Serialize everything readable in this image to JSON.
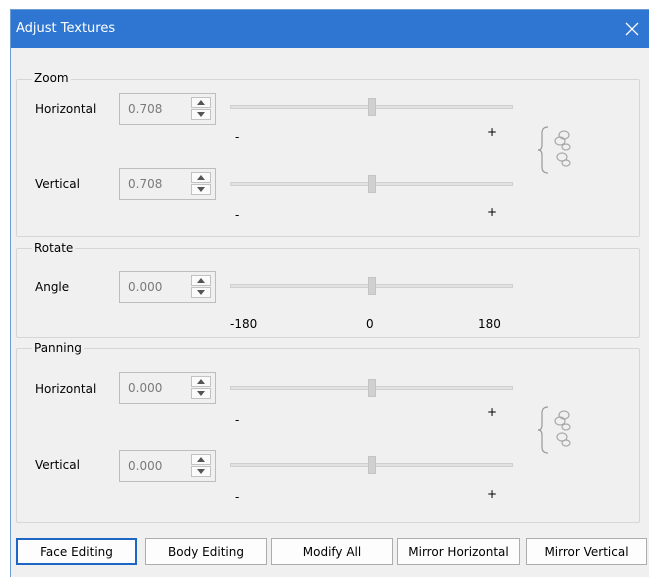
{
  "window": {
    "title": "Adjust Textures"
  },
  "icons": {
    "close": "close-icon",
    "link": "chain-link-icon",
    "up": "arrow-up-icon",
    "down": "arrow-down-icon"
  },
  "colors": {
    "titlebar": "#2e76d2",
    "accent": "#1e66c4"
  },
  "zoom": {
    "label": "Zoom",
    "horizontal": {
      "label": "Horizontal",
      "value": "0.708",
      "level": 0.5
    },
    "vertical": {
      "label": "Vertical",
      "value": "0.708",
      "level": 0.5
    },
    "min_label": "-",
    "max_label": "+"
  },
  "rotate": {
    "label": "Rotate",
    "angle": {
      "label": "Angle",
      "value": "0.000",
      "level": 0.5
    },
    "ticks": [
      "-180",
      "0",
      "180"
    ]
  },
  "panning": {
    "label": "Panning",
    "horizontal": {
      "label": "Horizontal",
      "value": "0.000",
      "level": 0.5
    },
    "vertical": {
      "label": "Vertical",
      "value": "0.000",
      "level": 0.5
    },
    "min_label": "-",
    "max_label": "+"
  },
  "buttons": {
    "face_editing": "Face Editing",
    "body_editing": "Body Editing",
    "modify_all": "Modify All",
    "mirror_horizontal": "Mirror Horizontal",
    "mirror_vertical": "Mirror Vertical"
  }
}
